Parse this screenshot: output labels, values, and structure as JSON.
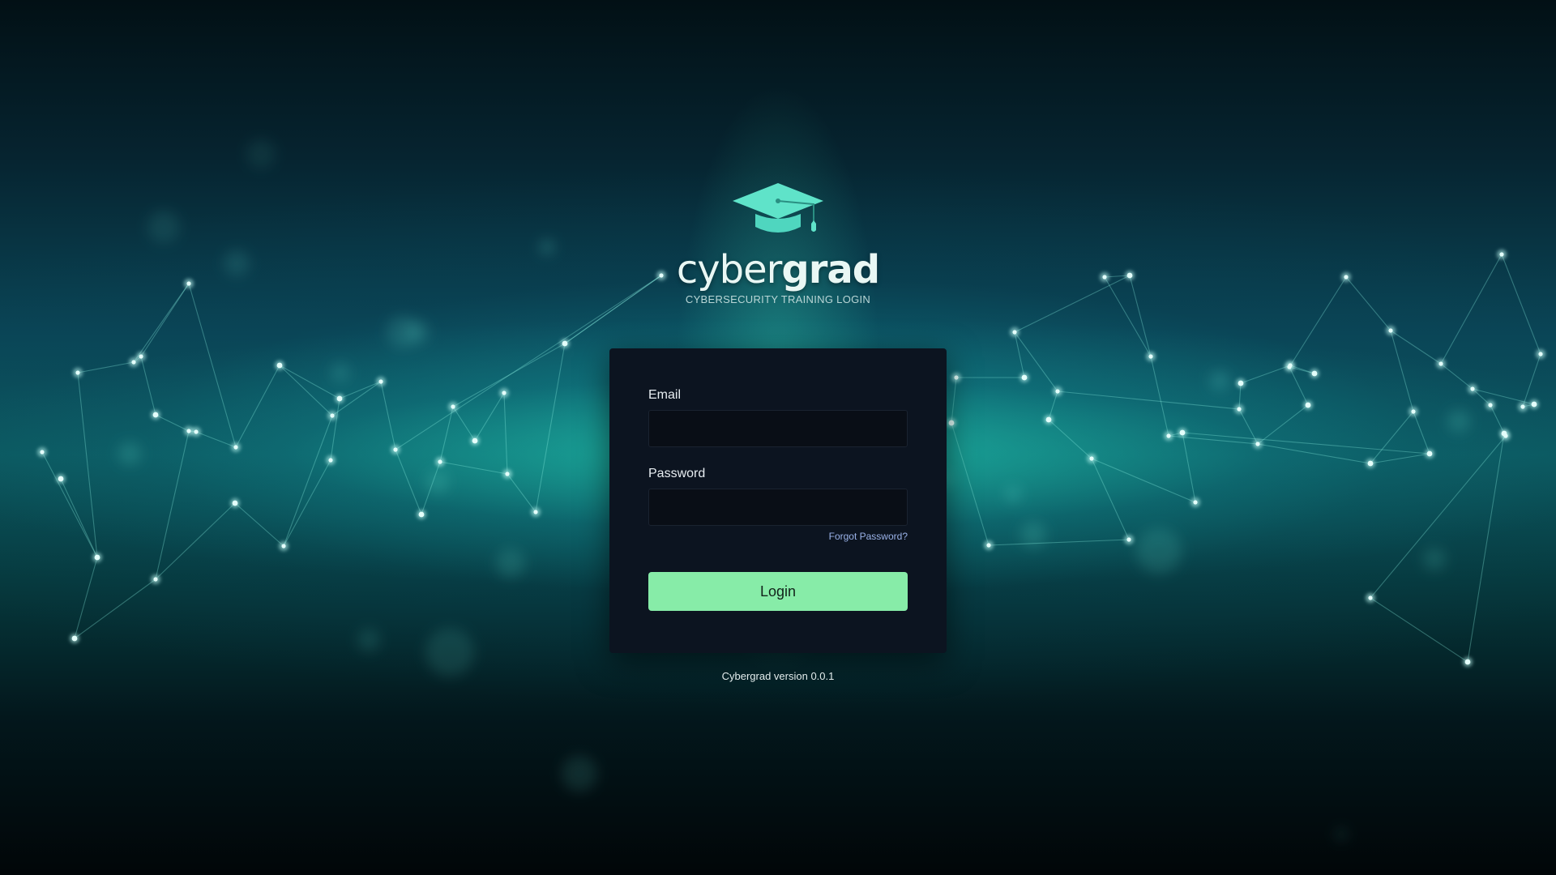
{
  "brand": {
    "logo_icon": "graduation-cap-icon",
    "name_light": "cyber",
    "name_bold": "grad",
    "tagline": "CYBERSECURITY TRAINING LOGIN",
    "accent_color": "#5fe3c9"
  },
  "login_form": {
    "email_label": "Email",
    "email_value": "",
    "password_label": "Password",
    "password_value": "",
    "forgot_password_label": "Forgot Password?",
    "login_button_label": "Login",
    "button_color": "#87eca8"
  },
  "footer": {
    "version_text": "Cybergrad version 0.0.1"
  }
}
